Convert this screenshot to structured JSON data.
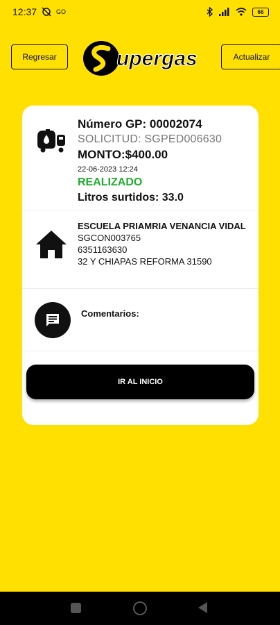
{
  "status_bar": {
    "time": "12:37",
    "carrier_mark": "GO",
    "battery": "66"
  },
  "header": {
    "back_label": "Regresar",
    "update_label": "Actualizar",
    "logo_text": "Supergas"
  },
  "order": {
    "number": "Número GP: 00002074",
    "request": "SOLICITUD: SGPED006630",
    "amount": "MONTO:$400.00",
    "date": "22-06-2023 12:24",
    "status": "REALIZADO",
    "liters": "Litros surtidos: 33.0"
  },
  "client": {
    "name": "ESCUELA PRIAMRIA VENANCIA VIDAL",
    "code": "SGCON003765",
    "phone": "6351163630",
    "address": "32 Y CHIAPAS REFORMA 31590"
  },
  "comments": {
    "label": "Comentarios:"
  },
  "actions": {
    "home_label": "IR AL INICIO"
  },
  "colors": {
    "background": "#FFE000",
    "status_ok": "#1FAF2C"
  },
  "icons": [
    "gas-truck-icon",
    "home-icon",
    "comment-icon"
  ]
}
